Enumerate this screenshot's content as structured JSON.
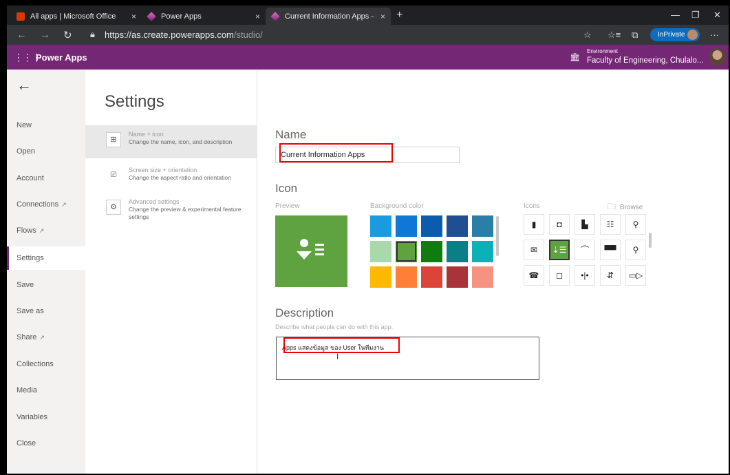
{
  "browser": {
    "tabs": [
      {
        "title": "All apps | Microsoft Office",
        "close": "×"
      },
      {
        "title": "Power Apps",
        "close": "×"
      },
      {
        "title": "Current Information Apps - Pow",
        "close": "×"
      }
    ],
    "new_tab": "+",
    "window_controls": {
      "minimize": "—",
      "restore": "❐",
      "close": "✕"
    },
    "url_host": "https://as.create.powerapps.com",
    "url_path": "/studio/",
    "inprivate": "InPrivate",
    "icons": {
      "back": "←",
      "forward": "→",
      "refresh": "↻",
      "lock": "🔒",
      "star": "☆",
      "favorites": "☆≡",
      "collections": "⧉",
      "more": "···"
    }
  },
  "header": {
    "waffle": "⋮⋮⋮",
    "app_name": "Power Apps",
    "environment_label": "Environment",
    "environment_value": "Faculty of Engineering, Chulalo..."
  },
  "leftnav": {
    "back": "←",
    "items": [
      {
        "label": "New"
      },
      {
        "label": "Open"
      },
      {
        "label": "Account"
      },
      {
        "label": "Connections",
        "external": "↗"
      },
      {
        "label": "Flows",
        "external": "↗"
      },
      {
        "label": "Settings",
        "selected": true
      },
      {
        "label": "Save"
      },
      {
        "label": "Save as"
      },
      {
        "label": "Share",
        "external": "↗"
      },
      {
        "label": "Collections"
      },
      {
        "label": "Media"
      },
      {
        "label": "Variables"
      },
      {
        "label": "Close"
      }
    ]
  },
  "settings": {
    "title": "Settings",
    "items": [
      {
        "heading": "Name + icon",
        "description": "Change the name, icon, and description",
        "icon": "⊞"
      },
      {
        "heading": "Screen size + orientation",
        "description": "Change the aspect ratio and orientation",
        "icon": "⎚"
      },
      {
        "heading": "Advanced settings",
        "description": "Change the preview & experimental feature settings",
        "icon": "⚙"
      }
    ]
  },
  "main": {
    "name_label": "Name",
    "name_value": "Current Information Apps",
    "icon_label": "Icon",
    "preview_label": "Preview",
    "background_label": "Background color",
    "icons_label": "Icons",
    "browse_label": "Browse",
    "description_label": "Description",
    "description_hint": "Describe what people can do with this app.",
    "description_value": "Apps แสดงข้อมูล ของ User ในทีมงาน",
    "preview_glyph": "⬤☰",
    "colors": [
      [
        "#1a9be0",
        "#0f78d4",
        "#0b5cad",
        "#204e92",
        "#2b7ea5"
      ],
      [
        "#a9d9a8",
        "#5ea33f",
        "#107c10",
        "#0a7f87",
        "#0bb1b6"
      ],
      [
        "#ffb900",
        "#ff7f36",
        "#db4437",
        "#a8343a",
        "#f4937f"
      ]
    ],
    "selected_color": "#5ea33f",
    "icon_glyphs": [
      [
        "▮",
        "◘",
        "▙",
        "☷",
        "⚲"
      ],
      [
        "✉",
        "⇣☰",
        "⌒",
        "▀▀",
        "⚲"
      ],
      [
        "☎",
        "◻",
        "•|•",
        "⇵",
        "▭▷"
      ]
    ]
  }
}
